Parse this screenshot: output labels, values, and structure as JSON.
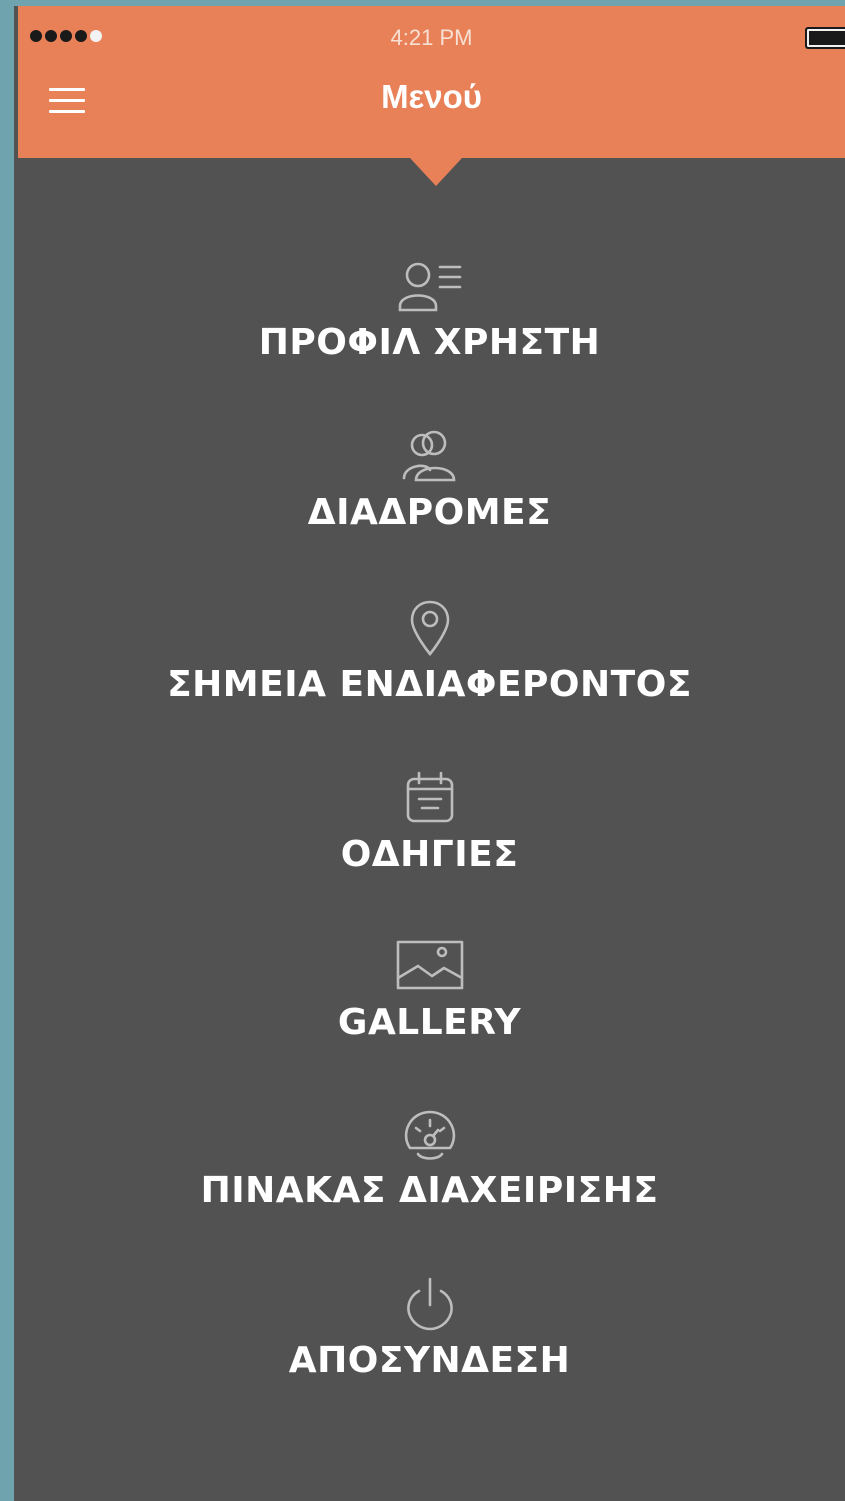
{
  "status_bar": {
    "time": "4:21 PM"
  },
  "header": {
    "title": "Μενού",
    "menu_icon": "hamburger-icon",
    "accent_color": "#e88157"
  },
  "background_color": "#525252",
  "menu": {
    "items": [
      {
        "label": "ΠΡΟΦΙΛ ΧΡΗΣΤΗ",
        "icon": "user-profile-icon"
      },
      {
        "label": "ΔΙΑΔΡΟΜΕΣ",
        "icon": "users-group-icon"
      },
      {
        "label": "ΣΗΜΕΙΑ ΕΝΔΙΑΦΕΡΟΝΤΟΣ",
        "icon": "map-pin-icon"
      },
      {
        "label": "ΟΔΗΓΙΕΣ",
        "icon": "calendar-icon"
      },
      {
        "label": "GALLERY",
        "icon": "image-icon"
      },
      {
        "label": "ΠΙΝΑΚΑΣ ΔΙΑΧΕΙΡΙΣΗΣ",
        "icon": "dashboard-gauge-icon"
      },
      {
        "label": "ΑΠΟΣΥΝΔΕΣΗ",
        "icon": "power-icon"
      }
    ]
  }
}
